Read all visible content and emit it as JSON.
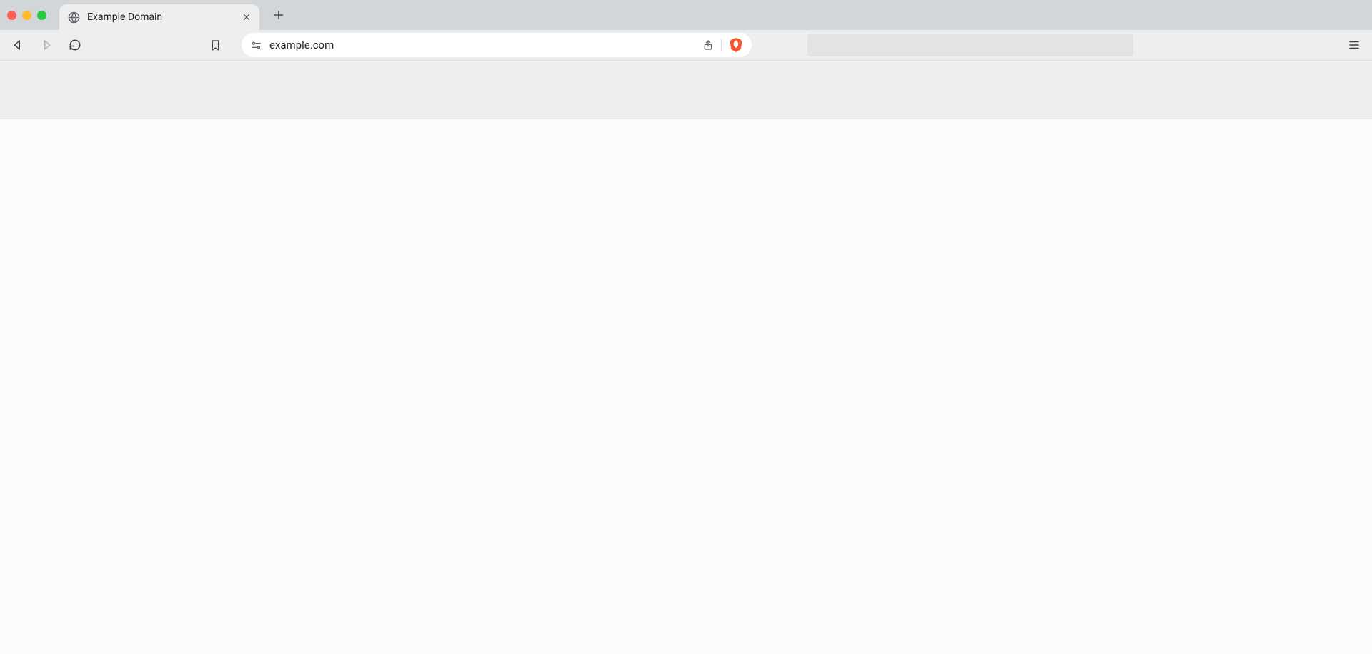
{
  "tab": {
    "title": "Example Domain",
    "favicon": "globe"
  },
  "omnibox": {
    "url": "example.com"
  }
}
